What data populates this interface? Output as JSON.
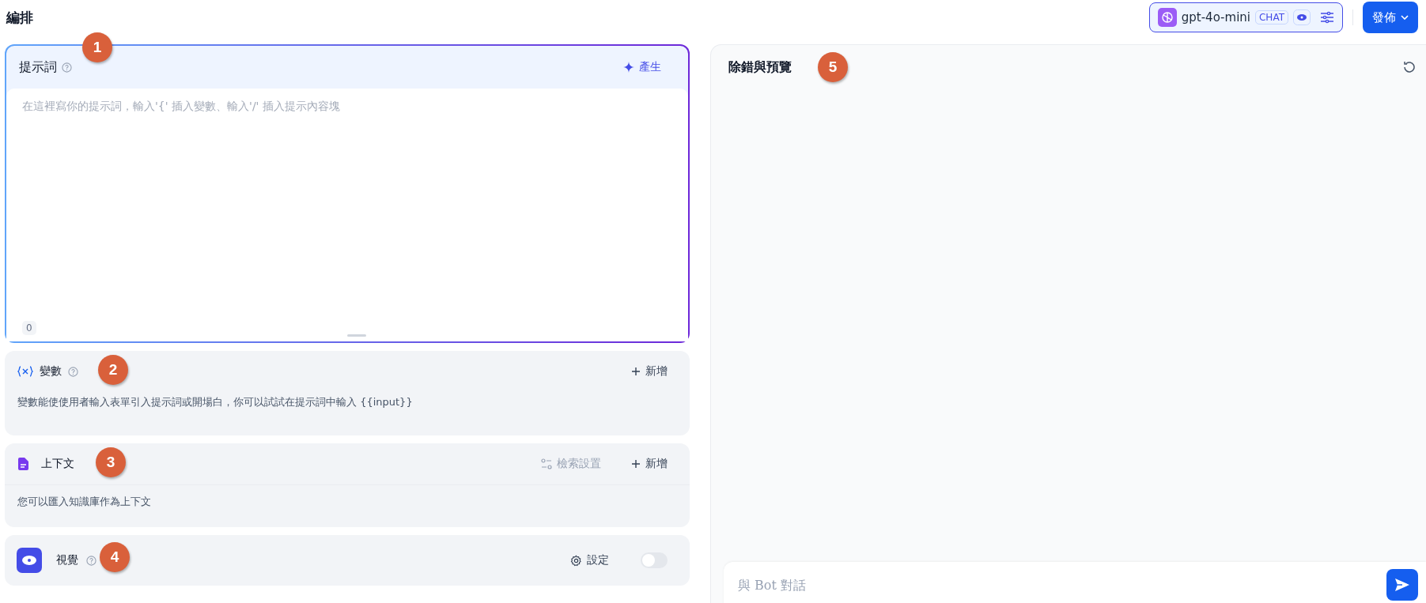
{
  "header": {
    "title": "編排",
    "model": {
      "name": "gpt-4o-mini",
      "mode": "CHAT"
    },
    "publish": "發佈"
  },
  "prompt": {
    "title": "提示詞",
    "marker": "1",
    "generate": "產生",
    "placeholder": "在這裡寫你的提示詞，輸入'{' 插入變數、輸入'/' 插入提示內容塊",
    "count": "0"
  },
  "variables": {
    "title": "變數",
    "marker": "2",
    "add": "新增",
    "description": "變數能使使用者輸入表單引入提示詞或開場白，你可以試試在提示詞中輸入 {{input}}"
  },
  "context": {
    "title": "上下文",
    "marker": "3",
    "settings": "檢索設置",
    "add": "新增",
    "description": "您可以匯入知識庫作為上下文"
  },
  "vision": {
    "title": "視覺",
    "marker": "4",
    "settings": "設定",
    "on": false
  },
  "debug": {
    "title": "除錯與預覽",
    "marker": "5",
    "chat_placeholder": "與 Bot 對話"
  }
}
